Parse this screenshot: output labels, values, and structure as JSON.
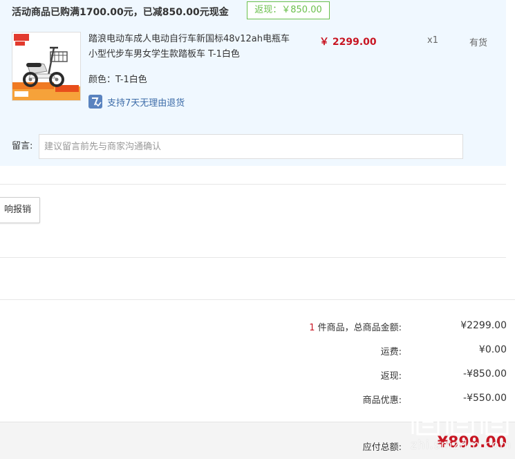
{
  "promotion": {
    "title": "活动商品已购满1700.00元，已减850.00元现金",
    "cashback_badge": "返现：￥850.00"
  },
  "product": {
    "thumbnail_icon": "electric-scooter-image",
    "name": "踏浪电动车成人电动自行车新国标48v12ah电瓶车小型代步车男女学生款踏板车 T-1白色",
    "spec": "颜色：T-1白色",
    "return_policy": "支持7天无理由退货",
    "return_icon": "return-policy-icon",
    "unit_price": "￥ 2299.00",
    "quantity": "x1",
    "stock_status": "有货"
  },
  "message": {
    "label": "留言:",
    "placeholder": "建议留言前先与商家沟通确认",
    "value": ""
  },
  "reimbursement_button": {
    "label": "响报销"
  },
  "summary": {
    "item_count": "1",
    "item_count_suffix": " 件商品，总商品金额:",
    "subtotal": "¥2299.00",
    "shipping_label": "运费:",
    "shipping": "¥0.00",
    "cashback_label": "返现:",
    "cashback": "-¥850.00",
    "discount_label": "商品优惠:",
    "discount": "-¥550.00",
    "payable_label": "应付总额:",
    "payable": "¥899.00"
  },
  "watermark": {
    "text": "zhi.smzdm.com"
  },
  "colors": {
    "panel_background": "#f0f8ff",
    "price_red": "#c81623",
    "cashback_green": "#6abf4b",
    "link_blue": "#3d6ca8"
  }
}
